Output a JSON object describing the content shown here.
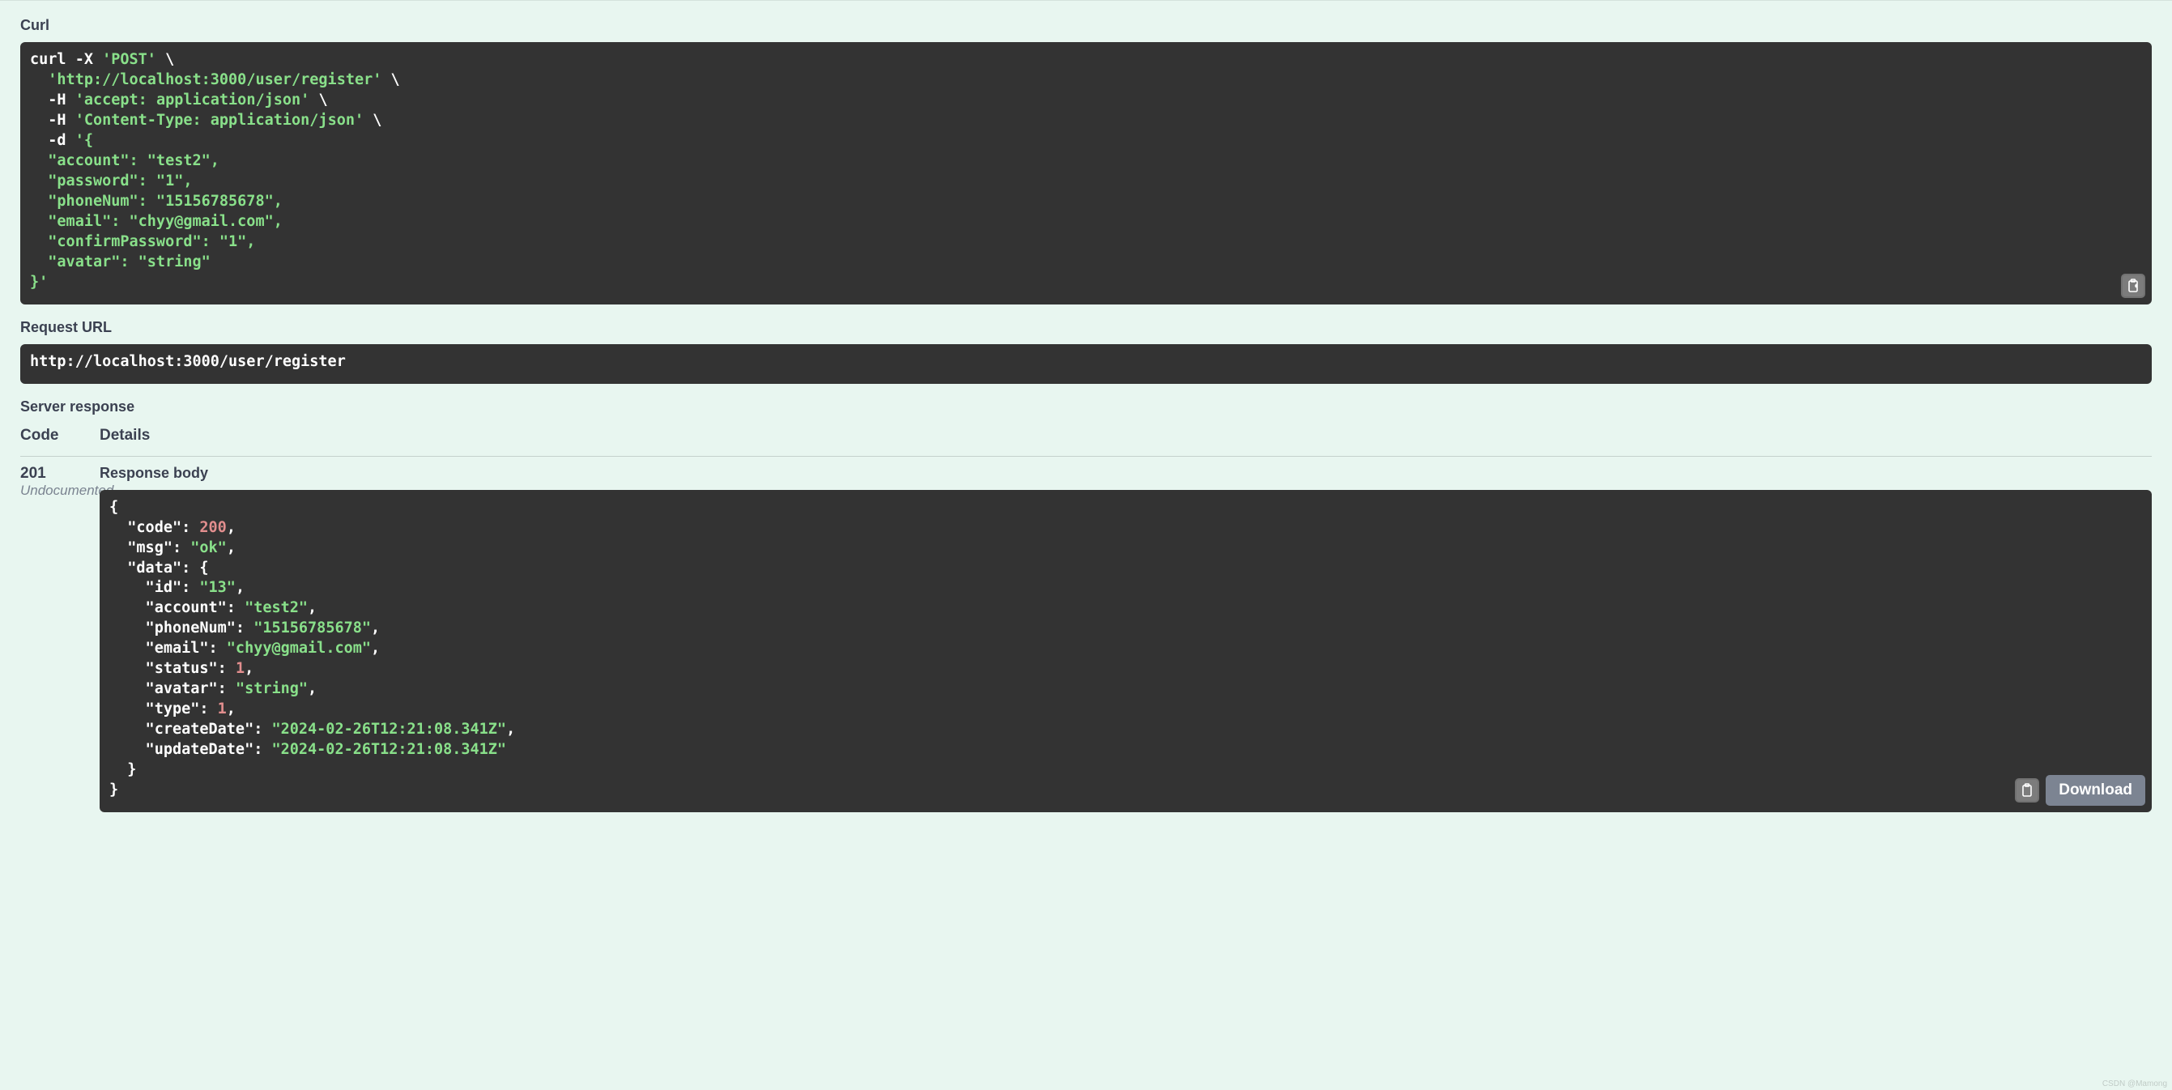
{
  "sections": {
    "curl_title": "Curl",
    "request_url_title": "Request URL",
    "server_response_title": "Server response",
    "code_header": "Code",
    "details_header": "Details",
    "response_body_title": "Response body"
  },
  "curl": {
    "command": "curl -X",
    "method": "'POST'",
    "url": "'http://localhost:3000/user/register'",
    "h1_flag": "  -H",
    "h1_val": "'accept: application/json'",
    "h2_flag": "  -H",
    "h2_val": "'Content-Type: application/json'",
    "d_flag": "  -d",
    "d_open": "'{",
    "body_lines": {
      "l1": "  \"account\": \"test2\",",
      "l2": "  \"password\": \"1\",",
      "l3": "  \"phoneNum\": \"15156785678\",",
      "l4": "  \"email\": \"chyy@gmail.com\",",
      "l5": "  \"confirmPassword\": \"1\",",
      "l6": "  \"avatar\": \"string\""
    },
    "d_close": "}'"
  },
  "request_url_value": "http://localhost:3000/user/register",
  "response": {
    "code": "201",
    "code_desc": "Undocumented",
    "body": {
      "open": "{",
      "code_key": "  \"code\": ",
      "code_val": "200",
      "msg_key": "  \"msg\": ",
      "msg_val": "\"ok\"",
      "data_key": "  \"data\": ",
      "data_open": "{",
      "id_key": "    \"id\": ",
      "id_val": "\"13\"",
      "account_key": "    \"account\": ",
      "account_val": "\"test2\"",
      "phone_key": "    \"phoneNum\": ",
      "phone_val": "\"15156785678\"",
      "email_key": "    \"email\": ",
      "email_val": "\"chyy@gmail.com\"",
      "status_key": "    \"status\": ",
      "status_val": "1",
      "avatar_key": "    \"avatar\": ",
      "avatar_val": "\"string\"",
      "type_key": "    \"type\": ",
      "type_val": "1",
      "create_key": "    \"createDate\": ",
      "create_val": "\"2024-02-26T12:21:08.341Z\"",
      "update_key": "    \"updateDate\": ",
      "update_val": "\"2024-02-26T12:21:08.341Z\"",
      "data_close": "  }",
      "close": "}"
    }
  },
  "buttons": {
    "download": "Download"
  },
  "watermark": "CSDN @Mamong"
}
